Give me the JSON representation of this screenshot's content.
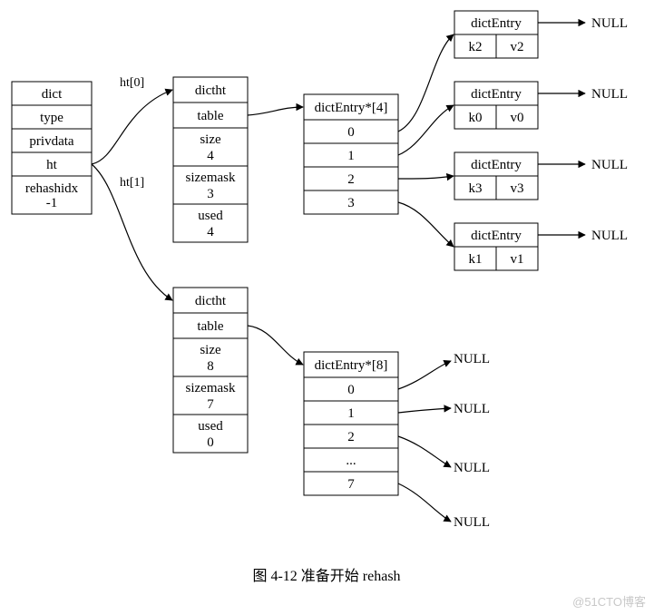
{
  "dict": {
    "title": "dict",
    "type": "type",
    "privdata": "privdata",
    "ht": "ht",
    "rehashidx_label": "rehashidx",
    "rehashidx_value": "-1"
  },
  "edges": {
    "ht0": "ht[0]",
    "ht1": "ht[1]"
  },
  "dictht0": {
    "title": "dictht",
    "table": "table",
    "size_label": "size",
    "size_value": "4",
    "sizemask_label": "sizemask",
    "sizemask_value": "3",
    "used_label": "used",
    "used_value": "4"
  },
  "dictht1": {
    "title": "dictht",
    "table": "table",
    "size_label": "size",
    "size_value": "8",
    "sizemask_label": "sizemask",
    "sizemask_value": "7",
    "used_label": "used",
    "used_value": "0"
  },
  "arr4": {
    "title": "dictEntry*[4]",
    "i0": "0",
    "i1": "1",
    "i2": "2",
    "i3": "3"
  },
  "arr8": {
    "title": "dictEntry*[8]",
    "i0": "0",
    "i1": "1",
    "i2": "2",
    "dots": "...",
    "i7": "7"
  },
  "entries": {
    "title": "dictEntry",
    "e0": {
      "k": "k2",
      "v": "v2"
    },
    "e1": {
      "k": "k0",
      "v": "v0"
    },
    "e2": {
      "k": "k3",
      "v": "v3"
    },
    "e3": {
      "k": "k1",
      "v": "v1"
    }
  },
  "null": "NULL",
  "caption": "图 4-12    准备开始 rehash",
  "watermark": "@51CTO博客"
}
